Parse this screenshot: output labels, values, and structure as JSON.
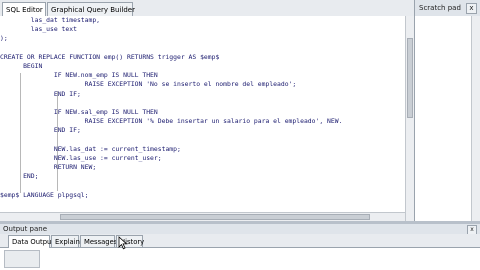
{
  "editor_tabs": [
    {
      "label": "SQL Editor",
      "active": true
    },
    {
      "label": "Graphical Query Builder",
      "active": false
    }
  ],
  "code_lines": [
    "        las_dat timestamp,",
    "        las_use text",
    ");",
    "",
    "CREATE OR REPLACE FUNCTION emp() RETURNS trigger AS $emp$",
    "      BEGIN",
    "              IF NEW.nom_emp IS NULL THEN",
    "                      RAISE EXCEPTION 'No se inserto el nombre del empleado';",
    "              END IF;",
    "",
    "              IF NEW.sal_emp IS NULL THEN",
    "                      RAISE EXCEPTION '% Debe insertar un salario para el empleado', NEW.",
    "              END IF;",
    "",
    "              NEW.las_dat := current_timestamp;",
    "              NEW.las_use := current_user;",
    "              RETURN NEW;",
    "      END;",
    "",
    "$emp$ LANGUAGE plpgsql;"
  ],
  "scratch_pad": {
    "title": "Scratch pad",
    "close_label": "x"
  },
  "output_pane": {
    "title": "Output pane",
    "close_label": "x",
    "tabs": [
      {
        "label": "Data Output",
        "active": true
      },
      {
        "label": "Explain",
        "active": false
      },
      {
        "label": "Messages",
        "active": false
      },
      {
        "label": "History",
        "active": false
      }
    ]
  },
  "colors": {
    "keyword": "#1a1a6e",
    "string": "#7a1a1a",
    "accent": "#9aa3ad"
  }
}
